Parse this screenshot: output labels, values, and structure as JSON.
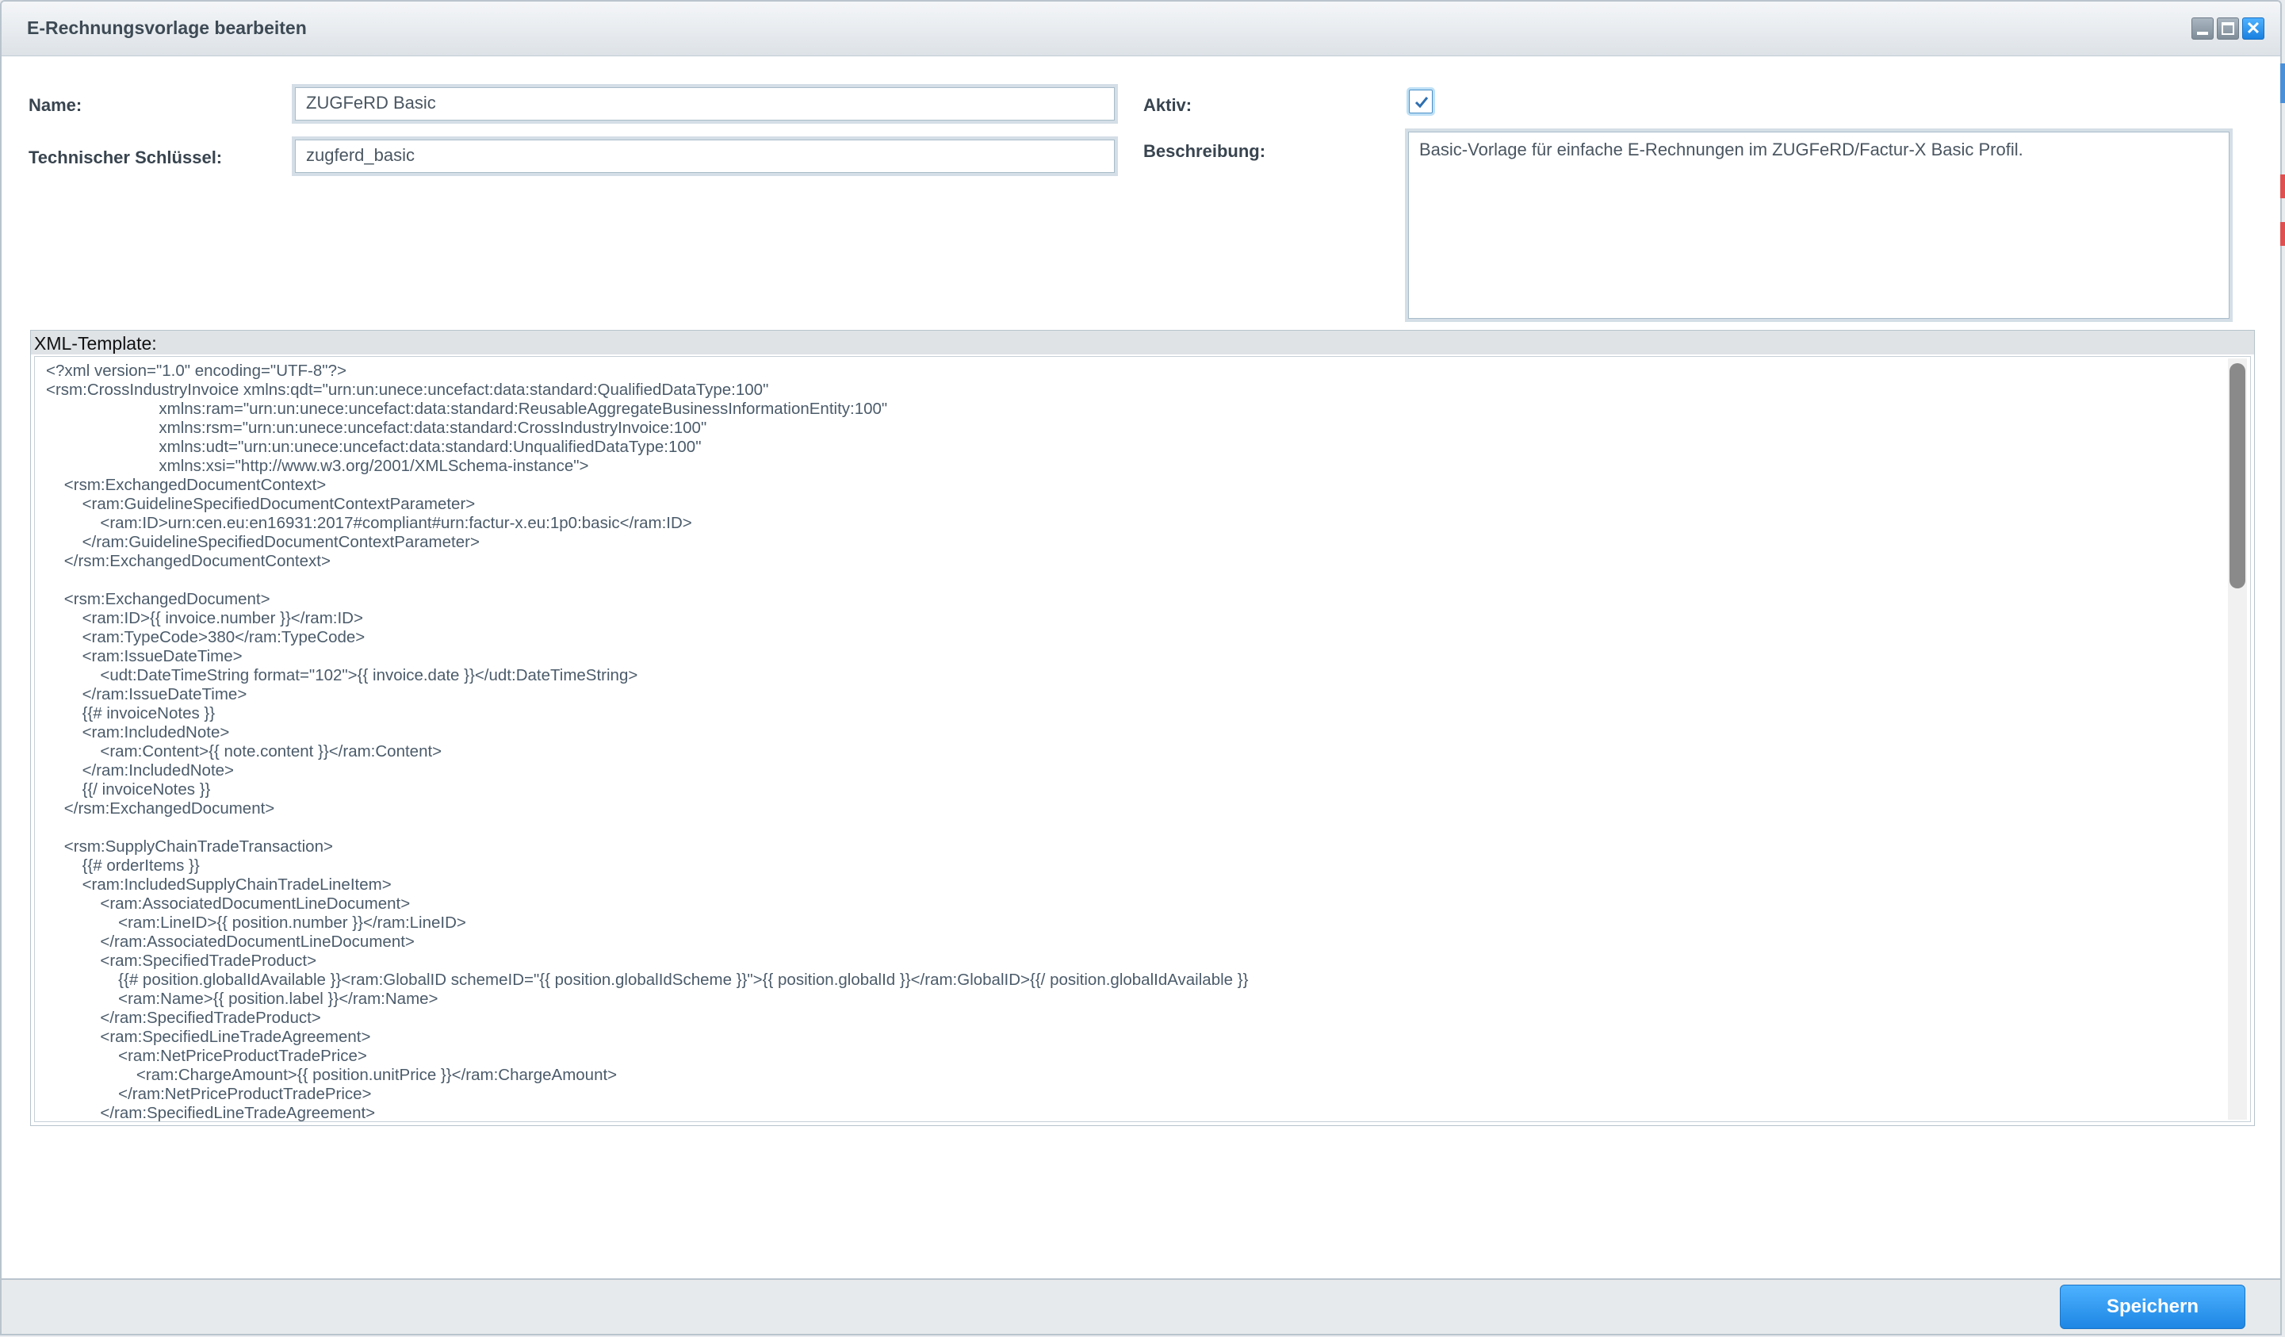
{
  "window": {
    "title": "E-Rechnungsvorlage bearbeiten"
  },
  "form": {
    "name_label": "Name:",
    "name_value": "ZUGFeRD Basic",
    "key_label": "Technischer Schlüssel:",
    "key_value": "zugferd_basic",
    "active_label": "Aktiv:",
    "active_checked": true,
    "description_label": "Beschreibung:",
    "description_value": "Basic-Vorlage für einfache E-Rechnungen im ZUGFeRD/Factur-X Basic Profil."
  },
  "xml": {
    "label": "XML-Template:",
    "content": "<?xml version=\"1.0\" encoding=\"UTF-8\"?>\n<rsm:CrossIndustryInvoice xmlns:qdt=\"urn:un:unece:uncefact:data:standard:QualifiedDataType:100\"\n                         xmlns:ram=\"urn:un:unece:uncefact:data:standard:ReusableAggregateBusinessInformationEntity:100\"\n                         xmlns:rsm=\"urn:un:unece:uncefact:data:standard:CrossIndustryInvoice:100\"\n                         xmlns:udt=\"urn:un:unece:uncefact:data:standard:UnqualifiedDataType:100\"\n                         xmlns:xsi=\"http://www.w3.org/2001/XMLSchema-instance\">\n    <rsm:ExchangedDocumentContext>\n        <ram:GuidelineSpecifiedDocumentContextParameter>\n            <ram:ID>urn:cen.eu:en16931:2017#compliant#urn:factur-x.eu:1p0:basic</ram:ID>\n        </ram:GuidelineSpecifiedDocumentContextParameter>\n    </rsm:ExchangedDocumentContext>\n\n    <rsm:ExchangedDocument>\n        <ram:ID>{{ invoice.number }}</ram:ID>\n        <ram:TypeCode>380</ram:TypeCode>\n        <ram:IssueDateTime>\n            <udt:DateTimeString format=\"102\">{{ invoice.date }}</udt:DateTimeString>\n        </ram:IssueDateTime>\n        {{# invoiceNotes }}\n        <ram:IncludedNote>\n            <ram:Content>{{ note.content }}</ram:Content>\n        </ram:IncludedNote>\n        {{/ invoiceNotes }}\n    </rsm:ExchangedDocument>\n\n    <rsm:SupplyChainTradeTransaction>\n        {{# orderItems }}\n        <ram:IncludedSupplyChainTradeLineItem>\n            <ram:AssociatedDocumentLineDocument>\n                <ram:LineID>{{ position.number }}</ram:LineID>\n            </ram:AssociatedDocumentLineDocument>\n            <ram:SpecifiedTradeProduct>\n                {{# position.globalIdAvailable }}<ram:GlobalID schemeID=\"{{ position.globalIdScheme }}\">{{ position.globalId }}</ram:GlobalID>{{/ position.globalIdAvailable }}\n                <ram:Name>{{ position.label }}</ram:Name>\n            </ram:SpecifiedTradeProduct>\n            <ram:SpecifiedLineTradeAgreement>\n                <ram:NetPriceProductTradePrice>\n                    <ram:ChargeAmount>{{ position.unitPrice }}</ram:ChargeAmount>\n                </ram:NetPriceProductTradePrice>\n            </ram:SpecifiedLineTradeAgreement>"
  },
  "footer": {
    "save_label": "Speichern"
  },
  "colors": {
    "accent": "#1e86e4",
    "text": "#4b5b6a"
  }
}
